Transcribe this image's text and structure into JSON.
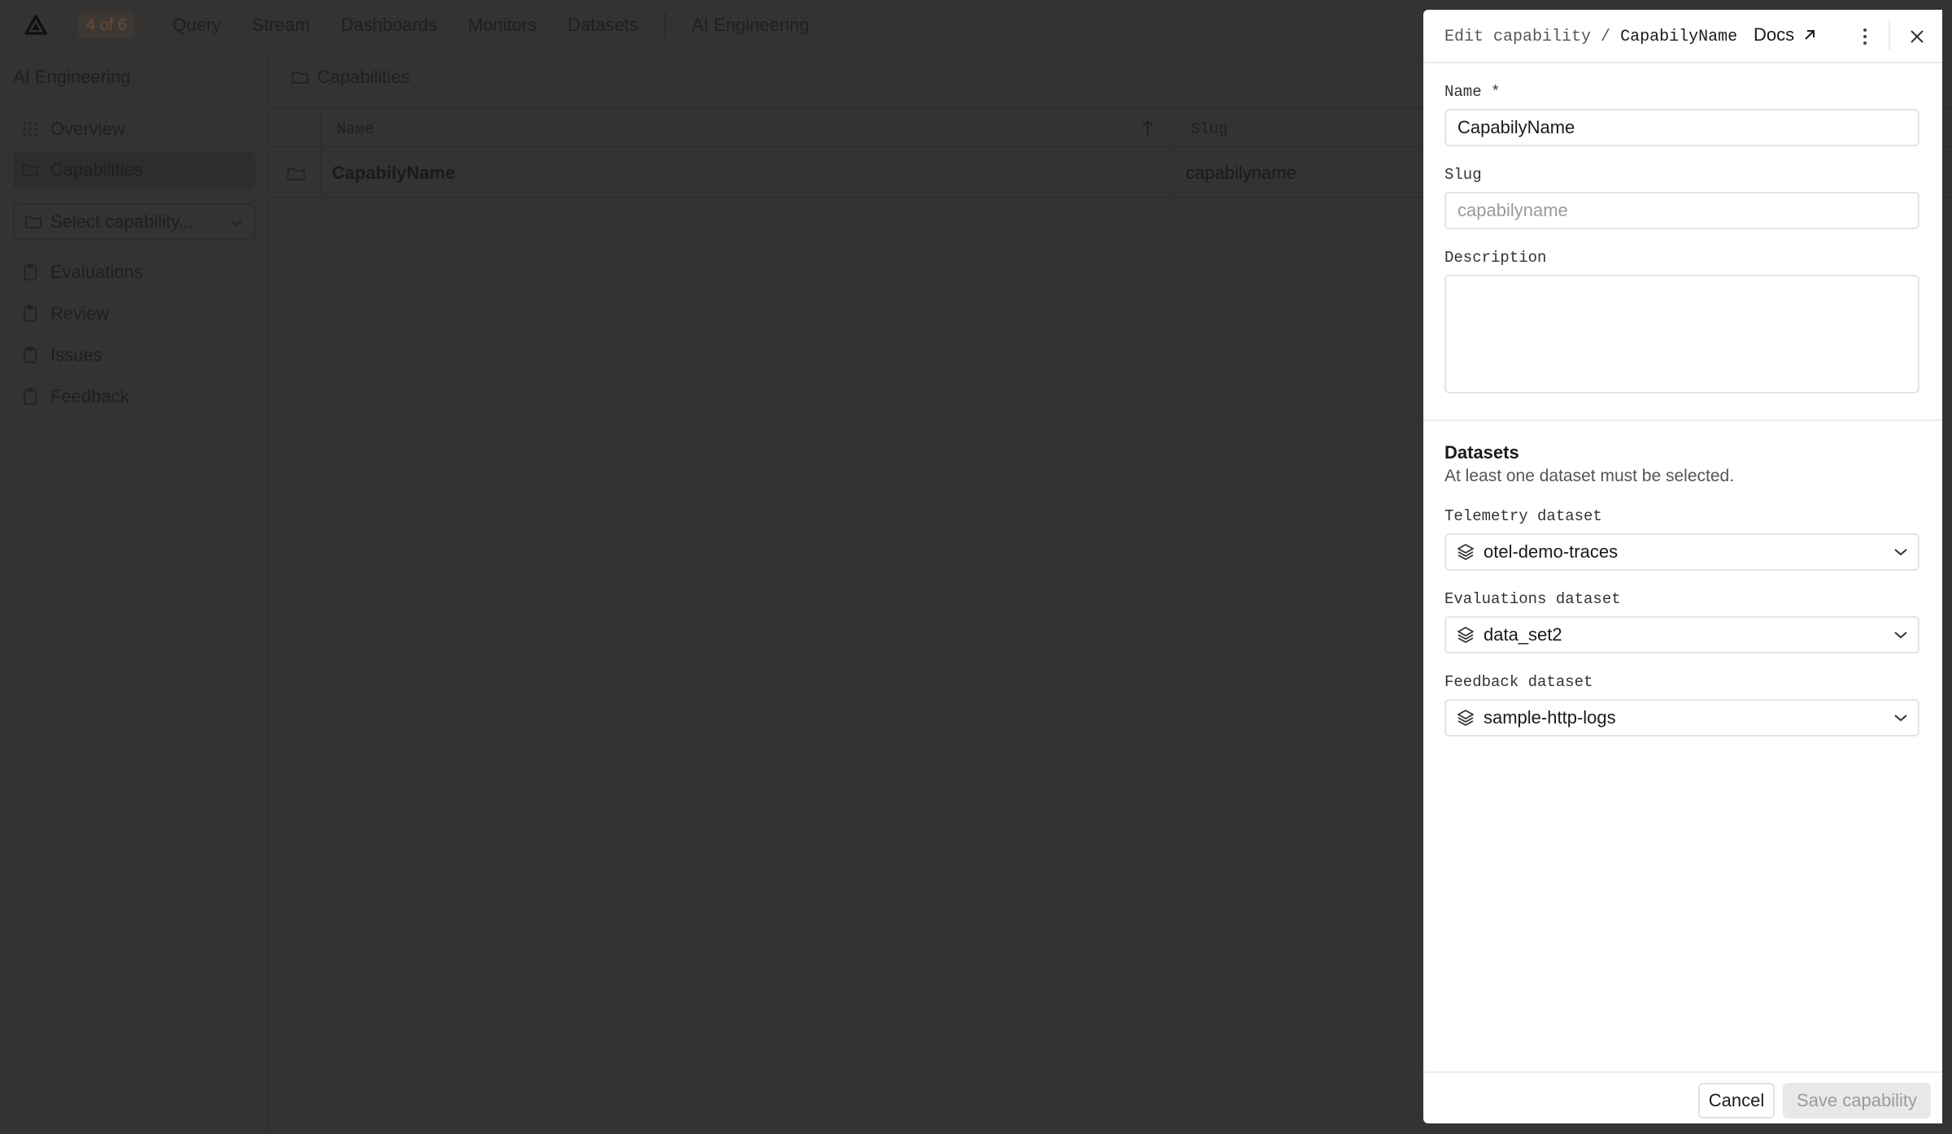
{
  "nav": {
    "badge": "4 of 6",
    "links": [
      "Query",
      "Stream",
      "Dashboards",
      "Monitors",
      "Datasets"
    ],
    "section": "AI Engineering"
  },
  "sidebar": {
    "title": "AI Engineering",
    "items": [
      {
        "label": "Overview",
        "icon": "grid-icon"
      },
      {
        "label": "Capabilities",
        "icon": "folder-icon"
      }
    ],
    "select_placeholder": "Select capability...",
    "sub_items": [
      {
        "label": "Evaluations",
        "icon": "clipboard-icon"
      },
      {
        "label": "Review",
        "icon": "clipboard-icon"
      },
      {
        "label": "Issues",
        "icon": "clipboard-icon"
      },
      {
        "label": "Feedback",
        "icon": "clipboard-icon"
      }
    ]
  },
  "main": {
    "breadcrumb": "Capabilities",
    "columns": {
      "name": "Name",
      "slug": "Slug"
    },
    "rows": [
      {
        "name": "CapabilyName",
        "slug": "capabilyname"
      }
    ]
  },
  "drawer": {
    "crumb_prefix": "Edit capability",
    "crumb_sep": "/",
    "crumb_current": "CapabilyName",
    "docs_label": "Docs",
    "name_label": "Name *",
    "name_value": "CapabilyName",
    "slug_label": "Slug",
    "slug_placeholder": "capabilyname",
    "description_label": "Description",
    "description_value": "",
    "datasets_title": "Datasets",
    "datasets_help": "At least one dataset must be selected.",
    "telemetry_label": "Telemetry dataset",
    "telemetry_value": "otel-demo-traces",
    "evaluations_label": "Evaluations dataset",
    "evaluations_value": "data_set2",
    "feedback_label": "Feedback dataset",
    "feedback_value": "sample-http-logs",
    "cancel_label": "Cancel",
    "save_label": "Save capability"
  }
}
